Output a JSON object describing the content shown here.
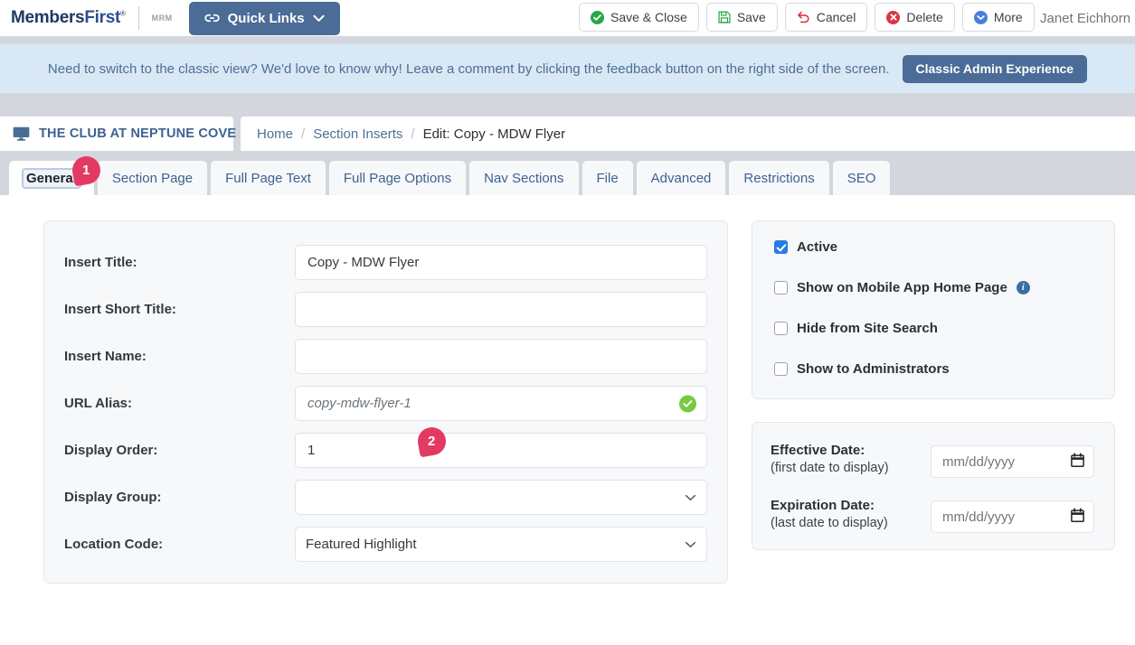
{
  "topbar": {
    "logo_members": "Members",
    "logo_first": "First",
    "logo_reg": "®",
    "product_tag": "MRM",
    "quick_links_label": "Quick Links",
    "user_name": "Janet Eichhorn",
    "buttons": [
      {
        "label": "Save & Close",
        "icon": "check-circle-icon",
        "color": "#28a745"
      },
      {
        "label": "Save",
        "icon": "floppy-disk-icon",
        "color": "#28a745"
      },
      {
        "label": "Cancel",
        "icon": "undo-arrow-icon",
        "color": "#dc3545"
      },
      {
        "label": "Delete",
        "icon": "x-circle-icon",
        "color": "#dc3545"
      },
      {
        "label": "More",
        "icon": "chevron-down-circle-icon",
        "color": "#4a7ddb"
      }
    ]
  },
  "banner": {
    "text": "Need to switch to the classic view? We'd love to know why! Leave a comment by clicking the feedback button on the right side of the screen.",
    "button_label": "Classic Admin Experience",
    "background": "#d9e8f5"
  },
  "breadcrumb": {
    "site_name": "THE CLUB AT NEPTUNE COVE",
    "site_icon": "monitor-icon",
    "items": [
      {
        "label": "Home",
        "current": false
      },
      {
        "label": "Section Inserts",
        "current": false
      },
      {
        "label": "Edit: Copy - MDW Flyer",
        "current": true
      }
    ],
    "separator": "/"
  },
  "tabs": [
    {
      "label": "General",
      "active": true
    },
    {
      "label": "Section Page",
      "active": false
    },
    {
      "label": "Full Page Text",
      "active": false
    },
    {
      "label": "Full Page Options",
      "active": false
    },
    {
      "label": "Nav Sections",
      "active": false
    },
    {
      "label": "File",
      "active": false
    },
    {
      "label": "Advanced",
      "active": false
    },
    {
      "label": "Restrictions",
      "active": false
    },
    {
      "label": "SEO",
      "active": false
    }
  ],
  "markers": [
    {
      "number": "1",
      "color": "#e23a63"
    },
    {
      "number": "2",
      "color": "#e23a63"
    }
  ],
  "form": {
    "insert_title": {
      "label": "Insert Title:",
      "value": "Copy - MDW Flyer",
      "placeholder": ""
    },
    "insert_short_title": {
      "label": "Insert Short Title:",
      "value": "",
      "placeholder": ""
    },
    "insert_name": {
      "label": "Insert Name:",
      "value": "",
      "placeholder": ""
    },
    "url_alias": {
      "label": "URL Alias:",
      "value": "copy-mdw-flyer-1",
      "placeholder": "",
      "valid": true,
      "valid_icon": "green-check-icon"
    },
    "display_order": {
      "label": "Display Order:",
      "value": "1",
      "placeholder": ""
    },
    "display_group": {
      "label": "Display Group:",
      "value": "",
      "options": [
        ""
      ]
    },
    "location_code": {
      "label": "Location Code:",
      "value": "Featured Highlight",
      "options": [
        "Featured Highlight"
      ]
    }
  },
  "options": {
    "checkboxes": [
      {
        "label": "Active",
        "checked": true,
        "info": false
      },
      {
        "label": "Show on Mobile App Home Page",
        "checked": false,
        "info": true,
        "info_icon": "info-icon"
      },
      {
        "label": "Hide from Site Search",
        "checked": false,
        "info": false
      },
      {
        "label": "Show to Administrators",
        "checked": false,
        "info": false
      }
    ]
  },
  "dates": {
    "effective": {
      "label": "Effective Date:",
      "sublabel": "(first date to display)",
      "value": "",
      "placeholder": "mm/dd/yyyy",
      "icon": "calendar-icon"
    },
    "expiration": {
      "label": "Expiration Date:",
      "sublabel": "(last date to display)",
      "value": "",
      "placeholder": "mm/dd/yyyy",
      "icon": "calendar-icon"
    }
  }
}
